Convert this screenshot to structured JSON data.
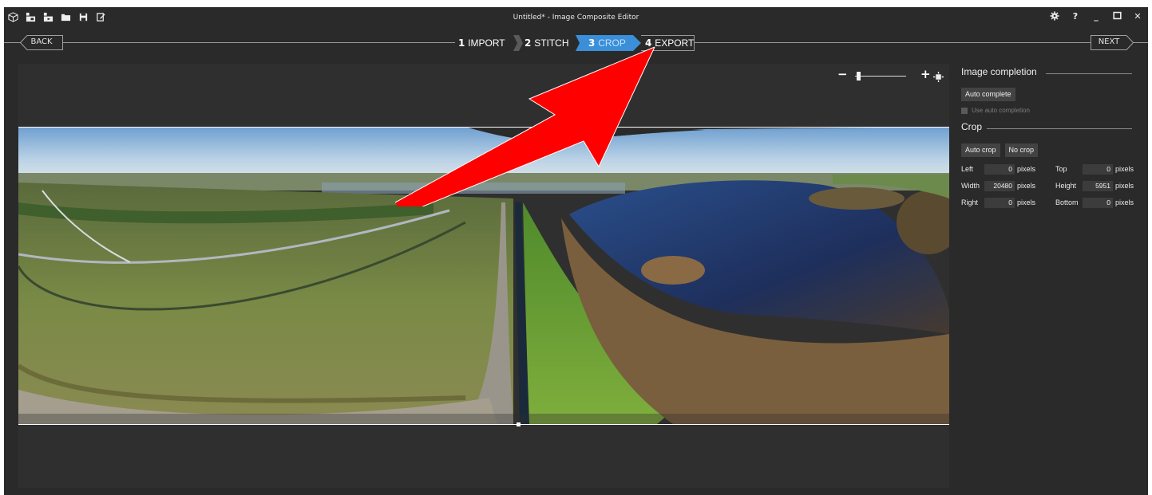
{
  "window": {
    "title": "Untitled* - Image Composite Editor",
    "controls": [
      "gear-icon",
      "help-icon",
      "minimize-icon",
      "maximize-icon",
      "close-icon"
    ]
  },
  "toolbar": {
    "icons": [
      "new-project-icon",
      "new-panorama-from-images-icon",
      "new-panorama-from-video-icon",
      "open-icon",
      "save-icon",
      "save-as-icon"
    ]
  },
  "nav": {
    "back_label": "BACK",
    "next_label": "NEXT",
    "steps": [
      {
        "num": "1",
        "label": "IMPORT",
        "active": false
      },
      {
        "num": "2",
        "label": "STITCH",
        "active": false
      },
      {
        "num": "3",
        "label": "CROP",
        "active": true
      },
      {
        "num": "4",
        "label": "EXPORT",
        "active": false
      }
    ]
  },
  "zoom": {
    "minus": "−",
    "plus": "+",
    "level": 0.05
  },
  "panel": {
    "image_completion": {
      "heading": "Image completion",
      "auto_complete_label": "Auto complete",
      "use_auto_completion_label": "Use auto completion"
    },
    "crop": {
      "heading": "Crop",
      "auto_crop_label": "Auto crop",
      "no_crop_label": "No crop",
      "fields": {
        "left": {
          "label": "Left",
          "value": "0",
          "unit": "pixels"
        },
        "top": {
          "label": "Top",
          "value": "0",
          "unit": "pixels"
        },
        "width": {
          "label": "Width",
          "value": "20480",
          "unit": "pixels"
        },
        "height": {
          "label": "Height",
          "value": "5951",
          "unit": "pixels"
        },
        "right": {
          "label": "Right",
          "value": "0",
          "unit": "pixels"
        },
        "bottom": {
          "label": "Bottom",
          "value": "0",
          "unit": "pixels"
        }
      }
    }
  },
  "colors": {
    "active_step": "#4fb0f5",
    "annotation_arrow": "#ff0000",
    "background": "#2a2a2a"
  }
}
